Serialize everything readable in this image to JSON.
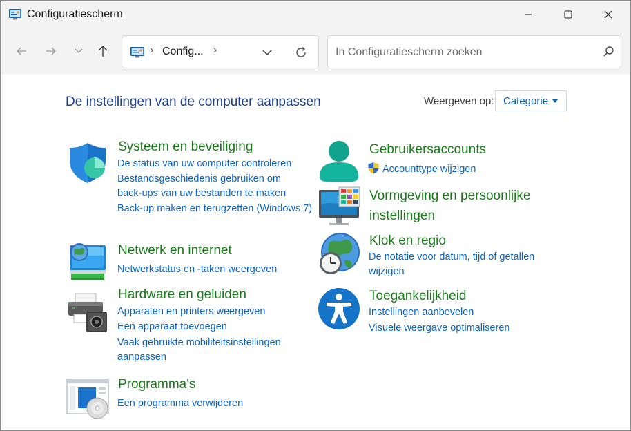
{
  "window": {
    "title": "Configuratiescherm"
  },
  "address": {
    "crumb": "Config..."
  },
  "search": {
    "placeholder": "In Configuratiescherm zoeken"
  },
  "main": {
    "heading": "De instellingen van de computer aanpassen",
    "view_label": "Weergeven op:",
    "view_value": "Categorie"
  },
  "categories": {
    "system": {
      "title": "Systeem en beveiliging",
      "links": [
        "De status van uw computer controleren",
        "Bestandsgeschiedenis gebruiken om back-ups van uw bestanden te maken",
        "Back-up maken en terugzetten (Windows 7)"
      ]
    },
    "network": {
      "title": "Netwerk en internet",
      "links": [
        "Netwerkstatus en -taken weergeven"
      ]
    },
    "hardware": {
      "title": "Hardware en geluiden",
      "links": [
        "Apparaten en printers weergeven",
        "Een apparaat toevoegen",
        "Vaak gebruikte mobiliteitsinstellingen aanpassen"
      ]
    },
    "programs": {
      "title": "Programma's",
      "links": [
        "Een programma verwijderen"
      ]
    },
    "users": {
      "title": "Gebruikersaccounts",
      "links": [
        "Accounttype wijzigen"
      ]
    },
    "appearance": {
      "title": "Vormgeving en persoonlijke instellingen",
      "links": []
    },
    "clock": {
      "title": "Klok en regio",
      "links": [
        "De notatie voor datum, tijd of getallen wijzigen"
      ]
    },
    "access": {
      "title": "Toegankelijkheid",
      "links": [
        "Instellingen aanbevelen",
        "Visuele weergave optimaliseren"
      ]
    }
  },
  "colors": {
    "title_green": "#1a7a1a",
    "link_blue": "#0b63c5",
    "heading_blue": "#1b3f8b"
  },
  "icons": [
    "control-panel-icon",
    "minimize-icon",
    "maximize-icon",
    "close-icon",
    "back-icon",
    "forward-icon",
    "recent-icon",
    "up-icon",
    "chevron-down-icon",
    "refresh-icon",
    "search-icon",
    "shield-icon",
    "network-icon",
    "printer-icon",
    "programs-icon",
    "user-icon",
    "uac-shield-icon",
    "monitor-icon",
    "clock-globe-icon",
    "accessibility-icon"
  ]
}
